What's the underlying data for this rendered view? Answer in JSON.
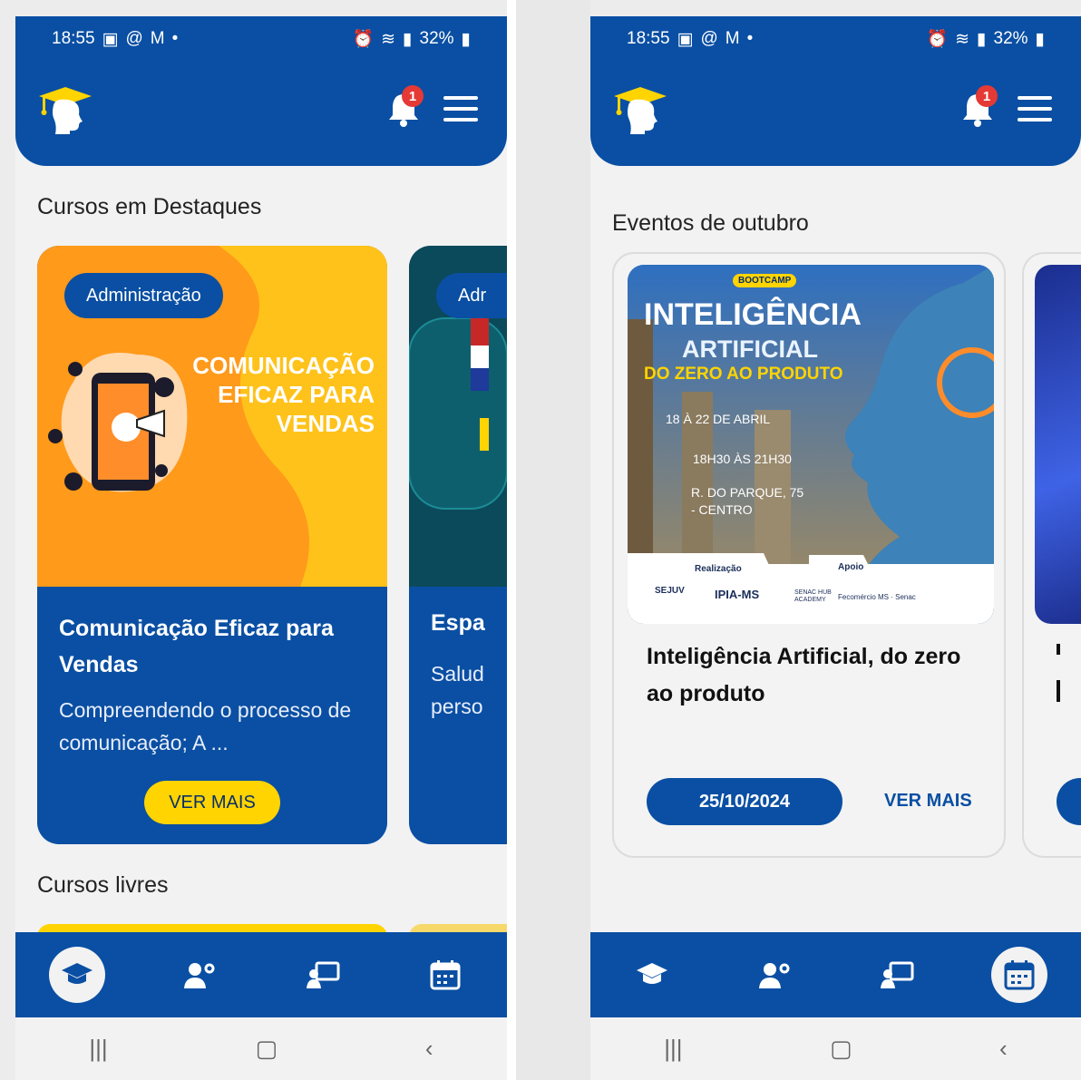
{
  "status_bar": {
    "time": "18:55",
    "battery": "32%"
  },
  "notifications": {
    "count": "1"
  },
  "left_screen": {
    "section_featured_title": "Cursos em Destaques",
    "featured_course": {
      "tag": "Administração",
      "art_line_1": "COMUNICAÇÃO",
      "art_line_2": "EFICAZ PARA",
      "art_line_3": "VENDAS",
      "title": "Comunicação Eficaz para Vendas",
      "description": "Compreendendo o processo de comunicação; A ...",
      "button": "VER MAIS"
    },
    "peek_course": {
      "tag": "Adr",
      "title": "Espa",
      "desc_line_1": "Salud",
      "desc_line_2": "perso"
    },
    "section_free_title": "Cursos livres"
  },
  "right_screen": {
    "section_title": "Eventos de outubro",
    "event": {
      "art_badge": "BOOTCAMP",
      "art_title_1": "INTELIGÊNCIA",
      "art_title_2": "ARTIFICIAL",
      "art_subtitle": "DO ZERO AO PRODUTO",
      "art_date": "18 À 22 DE ABRIL",
      "art_time": "18H30 ÀS 21H30",
      "art_place_1": "R. DO PARQUE, 75",
      "art_place_2": "- CENTRO",
      "art_realizacao": "Realização",
      "art_apoio": "Apoio",
      "art_logo_1": "SEJUV",
      "art_logo_2": "IPIA-MS",
      "art_logo_3": "SENAC HUB ACADEMY",
      "art_logo_4": "Fecomércio MS · Senac",
      "title": "Inteligência Artificial, do zero ao produto",
      "date": "25/10/2024",
      "link": "VER MAIS"
    }
  },
  "colors": {
    "primary": "#0a4fa3",
    "accent": "#ffd400",
    "orange": "#ff9a1a",
    "badge": "#e53935"
  },
  "nav_icons": [
    "graduation-cap-icon",
    "workers-icon",
    "teacher-board-icon",
    "calendar-icon"
  ]
}
